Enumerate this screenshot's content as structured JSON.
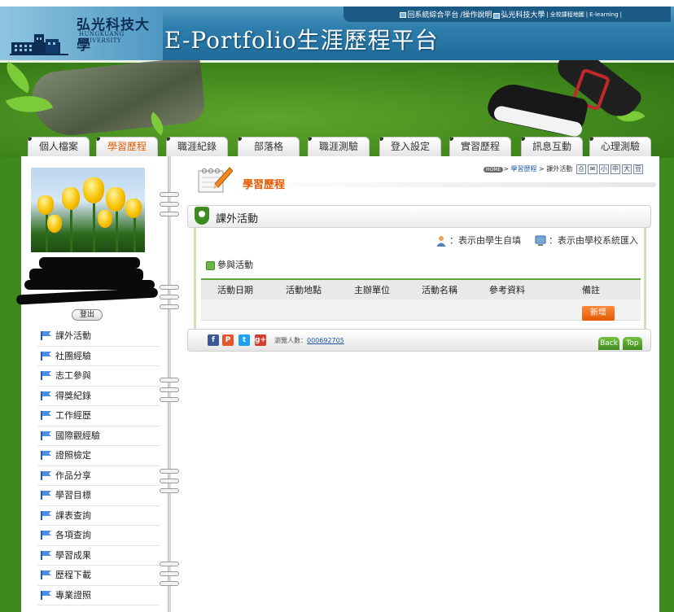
{
  "header": {
    "logo_cn": "弘光科技大學",
    "logo_en": "HUNGKUANG UNIVERSITY",
    "title": "E-Portfolio生涯歷程平台",
    "links": [
      "回系統綜合平台",
      "/操作說明",
      "弘光科技大學",
      "全校課程地圖",
      "E-learning"
    ]
  },
  "tabs": [
    "個人檔案",
    "學習歷程",
    "職涯紀錄",
    "部落格",
    "職涯測驗",
    "登入設定",
    "實習歷程",
    "訊息互動",
    "心理測驗"
  ],
  "active_tab": 1,
  "sidebar": {
    "logout_label": "登出",
    "menu": [
      "課外活動",
      "社團經驗",
      "志工參與",
      "得獎紀錄",
      "工作經歷",
      "國際觀經驗",
      "證照檢定",
      "作品分享",
      "學習目標",
      "課表查詢",
      "各項查詢",
      "學習成果",
      "歷程下載",
      "專業證照"
    ]
  },
  "breadcrumb": {
    "home": "HOME",
    "path_link": "學習歷程",
    "current": "課外活動"
  },
  "tool_icons": [
    "小",
    "中",
    "大",
    "豆"
  ],
  "page": {
    "title": "學習歷程",
    "section_title": "課外活動",
    "legend_student": "：表示由學生自填",
    "legend_school": "：表示由學校系統匯入",
    "sub_title": "參與活動",
    "columns": [
      "活動日期",
      "活動地點",
      "主辦單位",
      "活動名稱",
      "參考資料",
      "備註"
    ],
    "add_label": "新增"
  },
  "footer": {
    "visits_label": "瀏覽人數：",
    "visits_count": "000692705",
    "back_label": "Back",
    "top_label": "Top"
  },
  "colors": {
    "accent_orange": "#e45a00",
    "brand_green": "#3d8c22",
    "header_blue": "#2f7fae",
    "link_blue": "#1a55a8"
  }
}
